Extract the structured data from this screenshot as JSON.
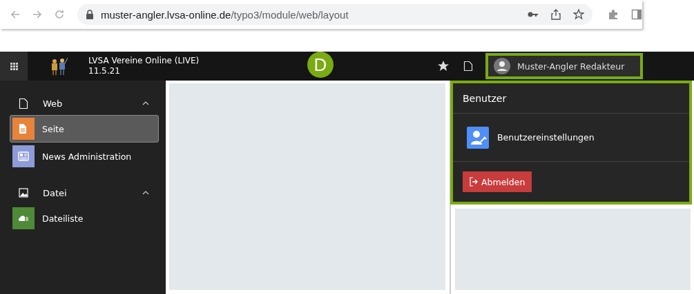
{
  "browser": {
    "url_host": "muster-angler.lvsa-online.de",
    "url_path": "/typo3/module/web/layout"
  },
  "topbar": {
    "site_name": "LVSA Vereine Online (LIVE)",
    "version": "11.5.21",
    "marker": "D",
    "user_name": "Muster-Angler Redakteur"
  },
  "sidebar": {
    "groups": [
      {
        "label": "Web",
        "kind": "page",
        "expanded": true,
        "items": [
          {
            "label": "Seite",
            "kind": "page",
            "color": "#e8833a",
            "selected": true
          },
          {
            "label": "News Administration",
            "kind": "news",
            "color": "#8e9bd8",
            "selected": false
          }
        ]
      },
      {
        "label": "Datei",
        "kind": "image",
        "expanded": true,
        "items": [
          {
            "label": "Dateiliste",
            "kind": "cloud",
            "color": "#4e8a38",
            "selected": false
          }
        ]
      }
    ]
  },
  "user_menu": {
    "title": "Benutzer",
    "items": [
      {
        "label": "Benutzereinstellungen"
      }
    ],
    "logout": "Abmelden"
  }
}
